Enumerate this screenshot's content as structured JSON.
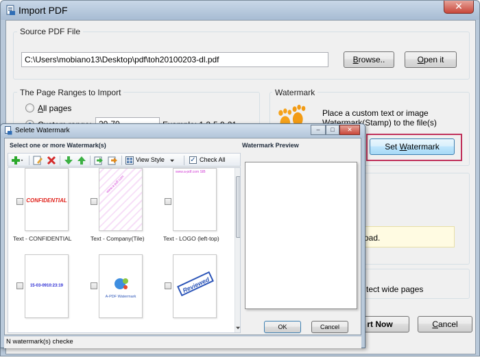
{
  "main_window": {
    "title": "Import PDF",
    "close_glyph": "✕"
  },
  "source": {
    "group_title": "Source PDF File",
    "path_value": "C:\\Users\\mobiano13\\Desktop\\pdf\\toh20100203-dl.pdf",
    "browse_label": "Browse..",
    "browse_mnemonic": "B",
    "open_label": "Open it",
    "open_mnemonic": "O"
  },
  "page_ranges": {
    "group_title": "The Page Ranges to Import",
    "all_pages_label": "All pages",
    "all_pages_mnemonic": "A",
    "custom_range_label": "Custom range:",
    "custom_range_value": "20-70",
    "example_text": "Example: 1,3-5,9-21"
  },
  "watermark": {
    "group_title": "Watermark",
    "description_line1": "Place a custom text or image",
    "description_line2": "Watermark(Stamp) to the file(s)",
    "set_button_label": "Set Watermark",
    "set_button_mnemonic": "W"
  },
  "main_fragments": {
    "load_text": "oad.",
    "wide_pages_text": "tect wide pages",
    "start_label": "rt Now",
    "cancel_label": "Cancel",
    "cancel_mnemonic": "C"
  },
  "dialog": {
    "title": "Selete Watermark",
    "minimize_glyph": "–",
    "maximize_glyph": "□",
    "close_glyph": "✕",
    "list_header": "Select one or more Watermark(s)",
    "preview_header": "Watermark Preview",
    "view_style_label": "View Style",
    "check_all_label": "Check All",
    "ok_label": "OK",
    "cancel_label": "Cancel",
    "status_text": "N watermark(s) checke",
    "items": [
      {
        "caption": "Text - CONFIDENTIAL",
        "thumb_text": "CONFIDENTIAL"
      },
      {
        "caption": "Text - Company(Tile)",
        "thumb_text": "www.a-pdf.com"
      },
      {
        "caption": "Text - LOGO (left-top)",
        "thumb_text": "www.a-pdf.com SIB"
      },
      {
        "caption": "",
        "thumb_text": "15-03-0910:23:19"
      },
      {
        "caption": "",
        "thumb_text": "A-PDF Watermark"
      },
      {
        "caption": "",
        "thumb_text": "Reviewed"
      }
    ]
  },
  "colors": {
    "highlight": "#c0305a",
    "confidential_red": "#e0231c",
    "tile_pink": "#d13bd4",
    "date_blue": "#2b2bd4",
    "reviewed_blue": "#2c55b8"
  }
}
